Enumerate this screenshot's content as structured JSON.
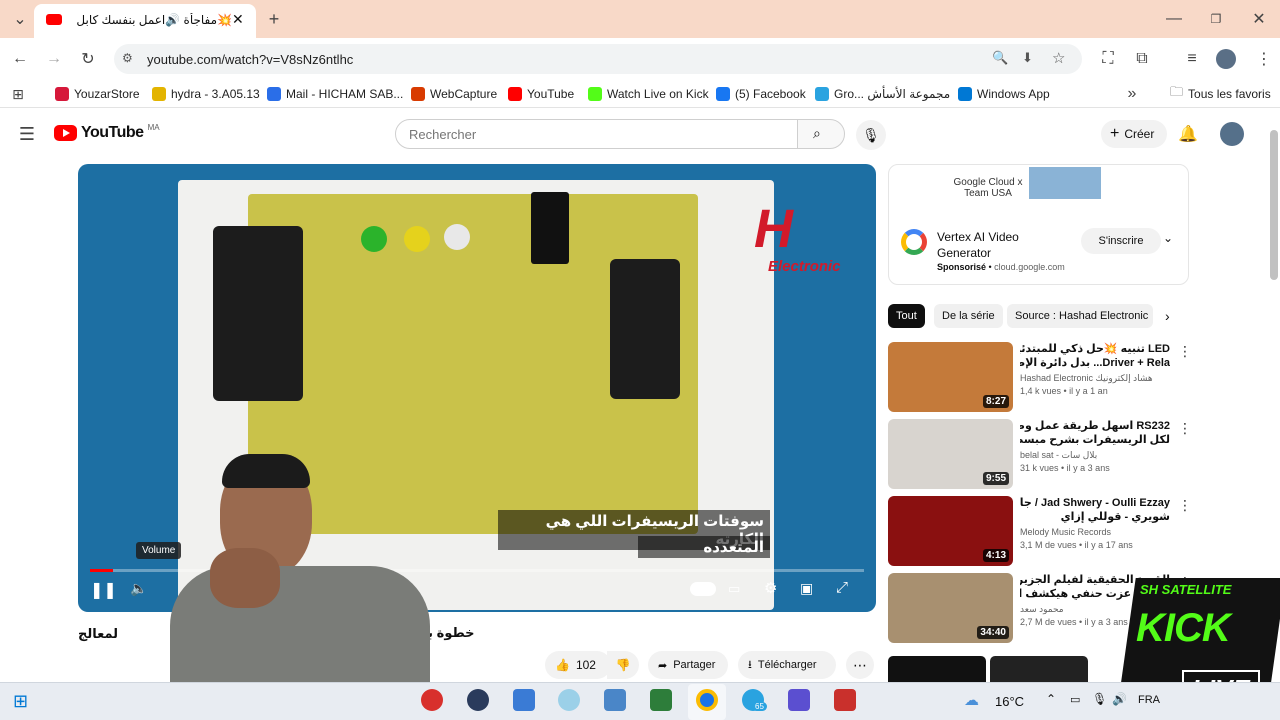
{
  "browser": {
    "tab_title": "💥مفاجأة 🔊اعمل بنفسك كابل",
    "url": "youtube.com/watch?v=V8sNz6ntlhc",
    "new_tab_symbol": "+",
    "bookmarks": [
      {
        "label": "YouzarStore",
        "color": "#d6183a"
      },
      {
        "label": "hydra - 3.A05.13",
        "color": "#e3b400"
      },
      {
        "label": "Mail - HICHAM SAB...",
        "color": "#2a6ee8"
      },
      {
        "label": "WebCapture",
        "color": "#d83b01"
      },
      {
        "label": "YouTube",
        "color": "#ff0000"
      },
      {
        "label": "Watch Live on Kick",
        "color": "#53fc18"
      },
      {
        "label": "(5) Facebook",
        "color": "#1877f2"
      },
      {
        "label": "Gro... مجموعة الأسأش",
        "color": "#2aa3e0"
      },
      {
        "label": "Windows App",
        "color": "#0078d4"
      }
    ],
    "all_bookmarks": "Tous les favoris"
  },
  "youtube": {
    "logo_text": "YouTube",
    "region": "MA",
    "search_placeholder": "Rechercher",
    "create_label": "Créer",
    "video": {
      "subtitle_line1": "سوفتات الريسيفرات اللي هي الكارته",
      "subtitle_line2": "المتعدده",
      "volume_tooltip": "Volume",
      "watermark": "Electronic",
      "progress": 0.03
    },
    "title_fragment_left": "لمعالج",
    "title_fragment_right": "خطوة بخطو",
    "actions": {
      "likes": "102",
      "share": "Partager",
      "download": "Télécharger"
    },
    "ad": {
      "banner": "Google Cloud x Team USA",
      "title": "Vertex AI Video Generator",
      "sponsored": "Sponsorisé",
      "domain": "cloud.google.com",
      "cta": "S'inscrire"
    },
    "chips": [
      "Tout",
      "De la série",
      "Source : Hashad Electronic"
    ],
    "recommendations": [
      {
        "title1": "LED تنبيه 💥حل ذكي للمبتدئين 🔗 تركيب",
        "title2": "Driver + Rela... بدل دائرة الإضاءة التالفة",
        "channel": "Hashad Electronic هشاد إلكترونيك",
        "meta": "1,4 k vues • il y a 1 an",
        "duration": "8:27",
        "thumb": "#c47a3a"
      },
      {
        "title1": "RS232 اسهل طريقة عمل وصلة تحديث",
        "title2": "لكل الريسيفرات بشرح مبسط جدا ولكل ...",
        "channel": "belal sat - بلال سات",
        "meta": "31 k vues • il y a 3 ans",
        "duration": "9:55",
        "thumb": "#d8d4cf"
      },
      {
        "title1": "Jad Shwery - Oulli Ezzay / جاد",
        "title2": "شويري - قوللي إزاي",
        "channel": "Melody Music Records",
        "meta": "3,1 M de vues • il y a 17 ans",
        "duration": "4:13",
        "thumb": "#8a1010"
      },
      {
        "title1": "القصة الحقيقية لفيلم الجزيرة .. ابن",
        "title2": "الصعيد عزت حنفي هيكشف اسرار",
        "channel": "محمود سعد",
        "meta": "2,7 M de vues • il y a 3 ans",
        "duration": "34:40",
        "thumb": "#a89070"
      }
    ]
  },
  "overlay": {
    "brand_top": "SH SATELLITE",
    "brand_kick": "KICK",
    "brand_live": "LIVE"
  },
  "taskbar": {
    "temperature": "16°C",
    "language": "FRA",
    "telegram_badge": "65"
  }
}
